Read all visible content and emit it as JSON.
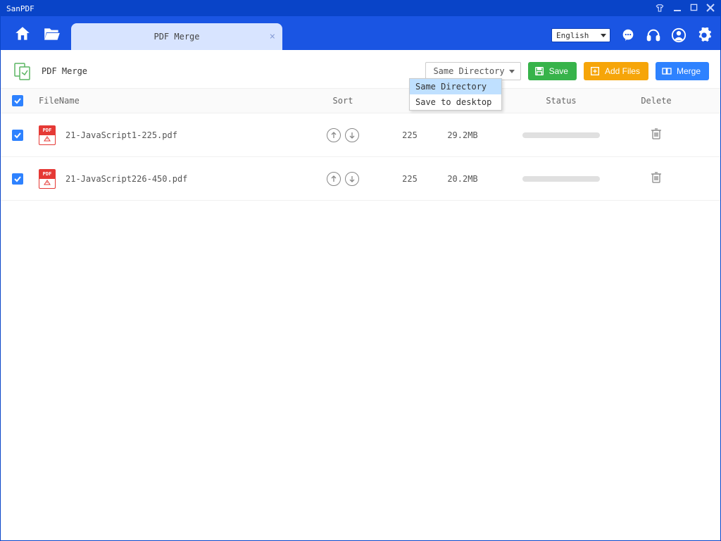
{
  "app": {
    "title": "SanPDF"
  },
  "tab": {
    "label": "PDF Merge"
  },
  "language": {
    "selected": "English"
  },
  "page": {
    "title": "PDF Merge"
  },
  "directory": {
    "selected": "Same Directory",
    "options": [
      "Same Directory",
      "Save to desktop"
    ]
  },
  "buttons": {
    "save": "Save",
    "addFiles": "Add Files",
    "merge": "Merge"
  },
  "columns": {
    "filename": "FileName",
    "sort": "Sort",
    "pages": "",
    "size": "",
    "status": "Status",
    "delete": "Delete"
  },
  "rows": [
    {
      "name": "21-JavaScript1-225.pdf",
      "pages": "225",
      "size": "29.2MB"
    },
    {
      "name": "21-JavaScript226-450.pdf",
      "pages": "225",
      "size": "20.2MB"
    }
  ],
  "colors": {
    "primary": "#1a55e3",
    "titlebar": "#0944c8",
    "accentBlue": "#2e82ff",
    "accentGreen": "#37b34a",
    "accentOrange": "#f6a509"
  }
}
